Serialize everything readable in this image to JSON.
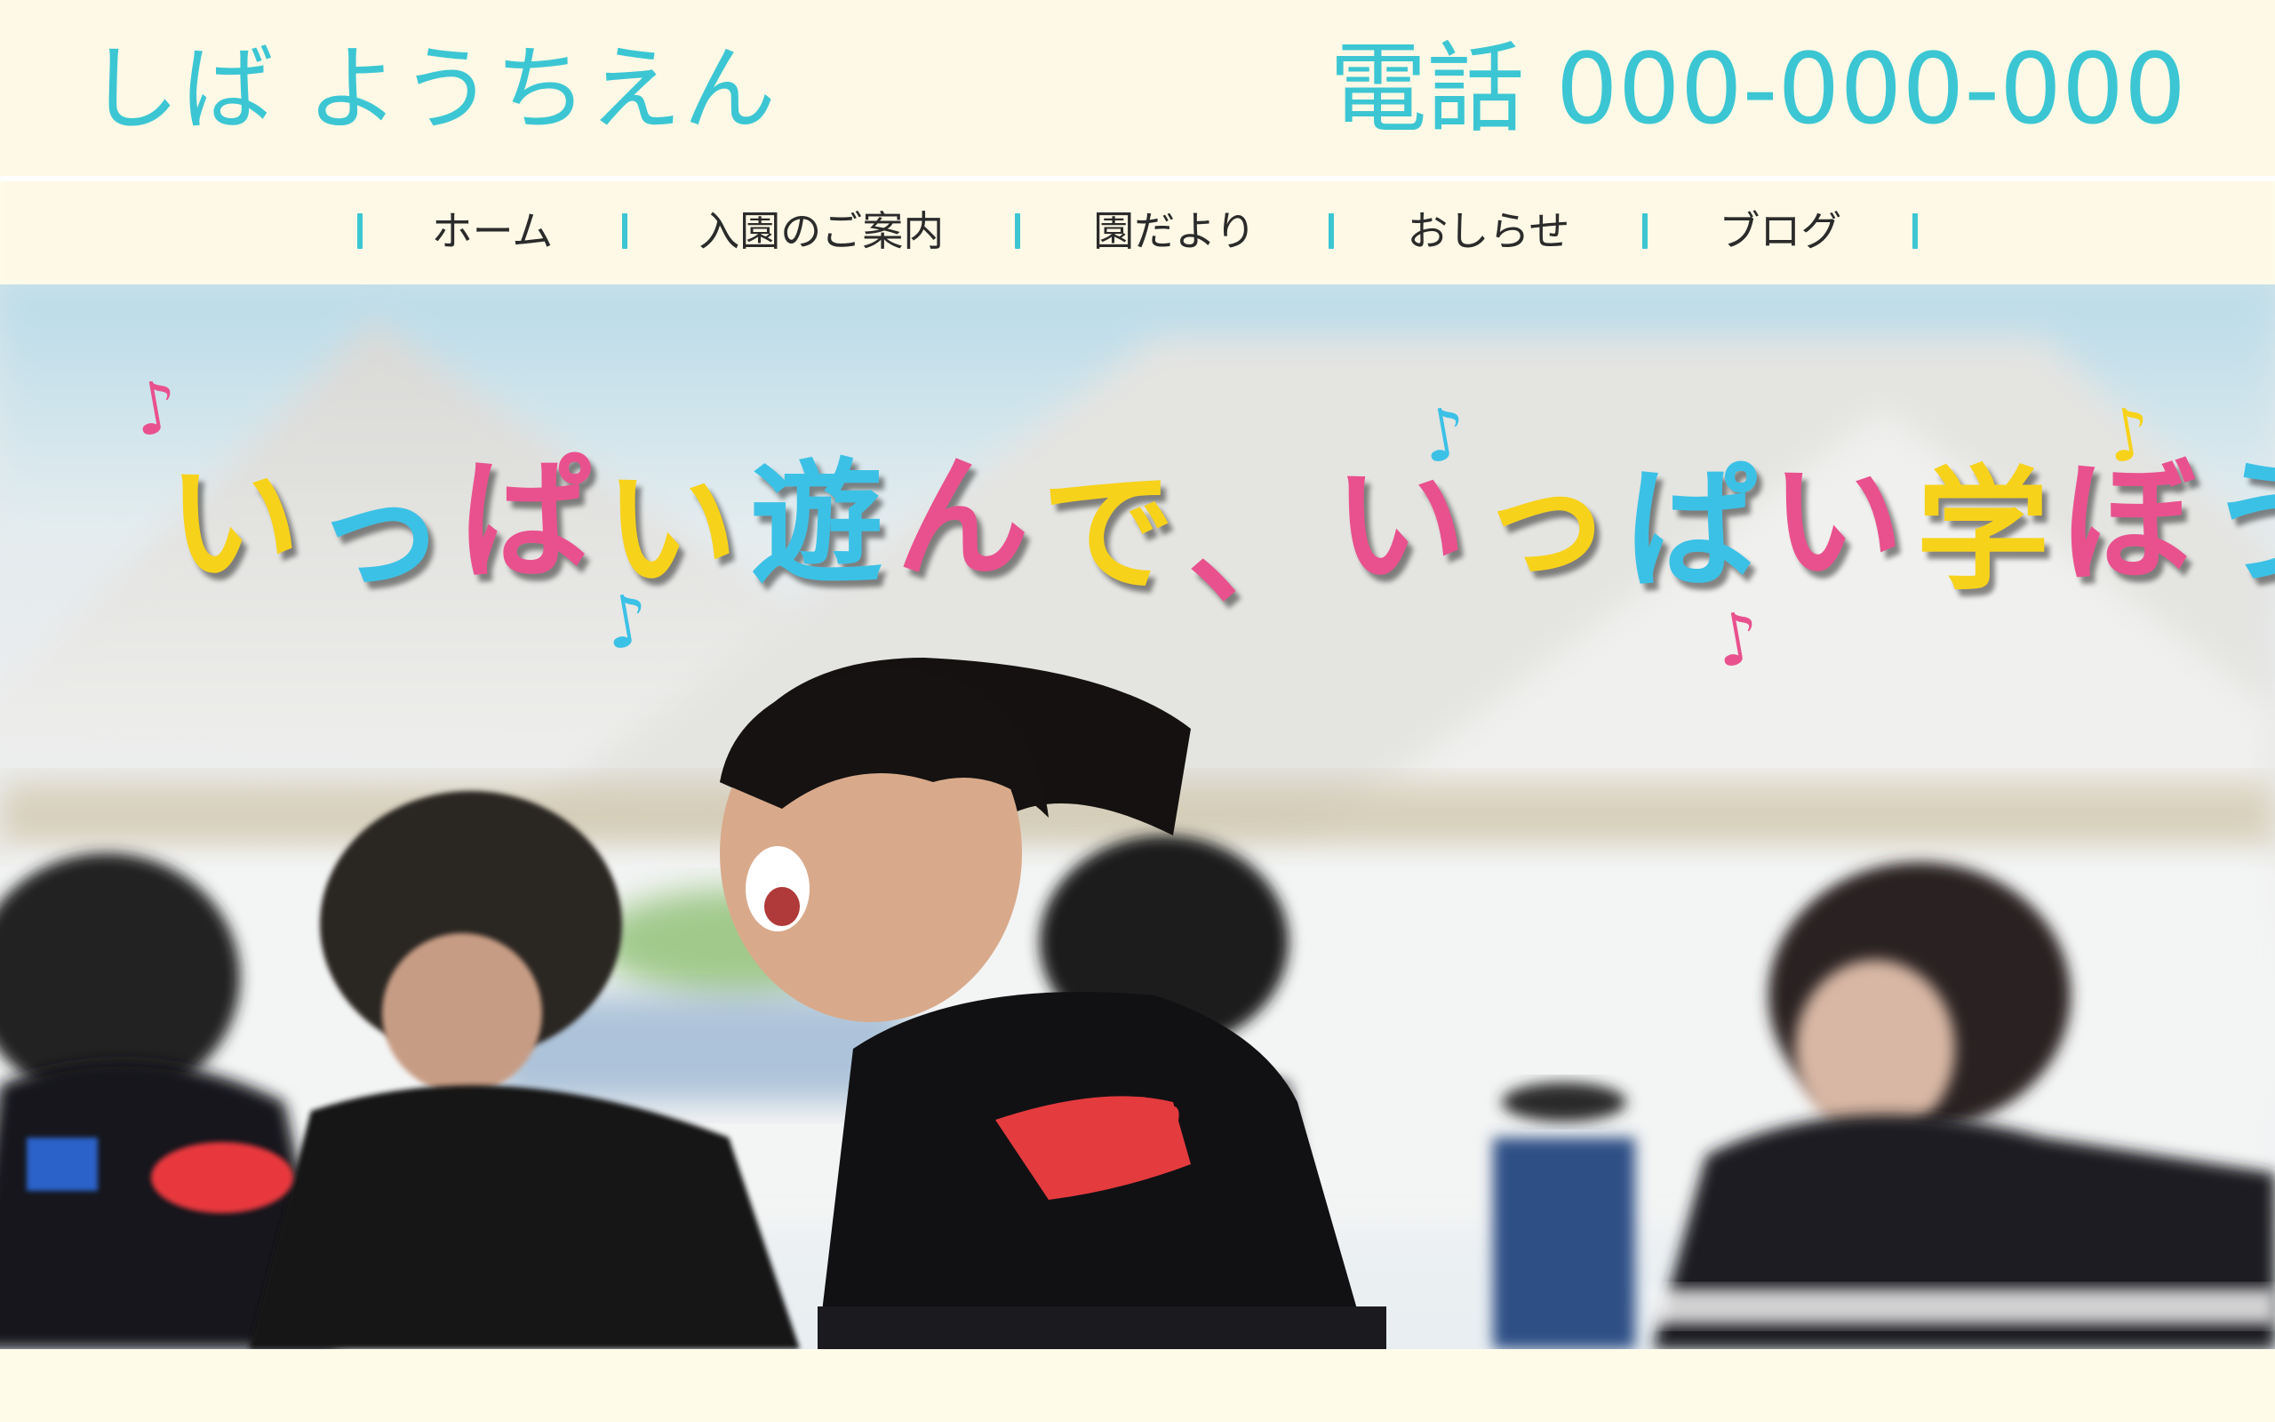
{
  "header": {
    "site_title": "しば ようちえん",
    "phone": "電話 000-000-000"
  },
  "nav": {
    "items": [
      {
        "label": "ホーム"
      },
      {
        "label": "入園のご案内"
      },
      {
        "label": "園だより"
      },
      {
        "label": "おしらせ"
      },
      {
        "label": "ブログ"
      }
    ]
  },
  "hero": {
    "slogan_chars": [
      {
        "ch": "い",
        "color": "#f7d21b"
      },
      {
        "ch": "っ",
        "color": "#3cc1e6"
      },
      {
        "ch": "ぱ",
        "color": "#e9518e"
      },
      {
        "ch": "い",
        "color": "#f7d21b"
      },
      {
        "ch": "遊",
        "color": "#3cc1e6"
      },
      {
        "ch": "ん",
        "color": "#e9518e"
      },
      {
        "ch": "で",
        "color": "#f7d21b"
      },
      {
        "ch": "、",
        "color": "#e9518e"
      },
      {
        "ch": "い",
        "color": "#e9518e"
      },
      {
        "ch": "っ",
        "color": "#f7d21b"
      },
      {
        "ch": "ぱ",
        "color": "#3cc1e6"
      },
      {
        "ch": "い",
        "color": "#e9518e"
      },
      {
        "ch": "学",
        "color": "#f7d21b"
      },
      {
        "ch": "ぼ",
        "color": "#e9518e"
      },
      {
        "ch": "う",
        "color": "#3cc1e6"
      }
    ],
    "notes": [
      {
        "glyph": "♪",
        "color": "#e9518e"
      },
      {
        "glyph": "♪",
        "color": "#3cc1e6"
      },
      {
        "glyph": "♪",
        "color": "#f7d21b"
      },
      {
        "glyph": "♪",
        "color": "#3cc1e6"
      },
      {
        "glyph": "♪",
        "color": "#e9518e"
      }
    ]
  },
  "colors": {
    "accent": "#3cc6d3",
    "background": "#fef9e6"
  }
}
